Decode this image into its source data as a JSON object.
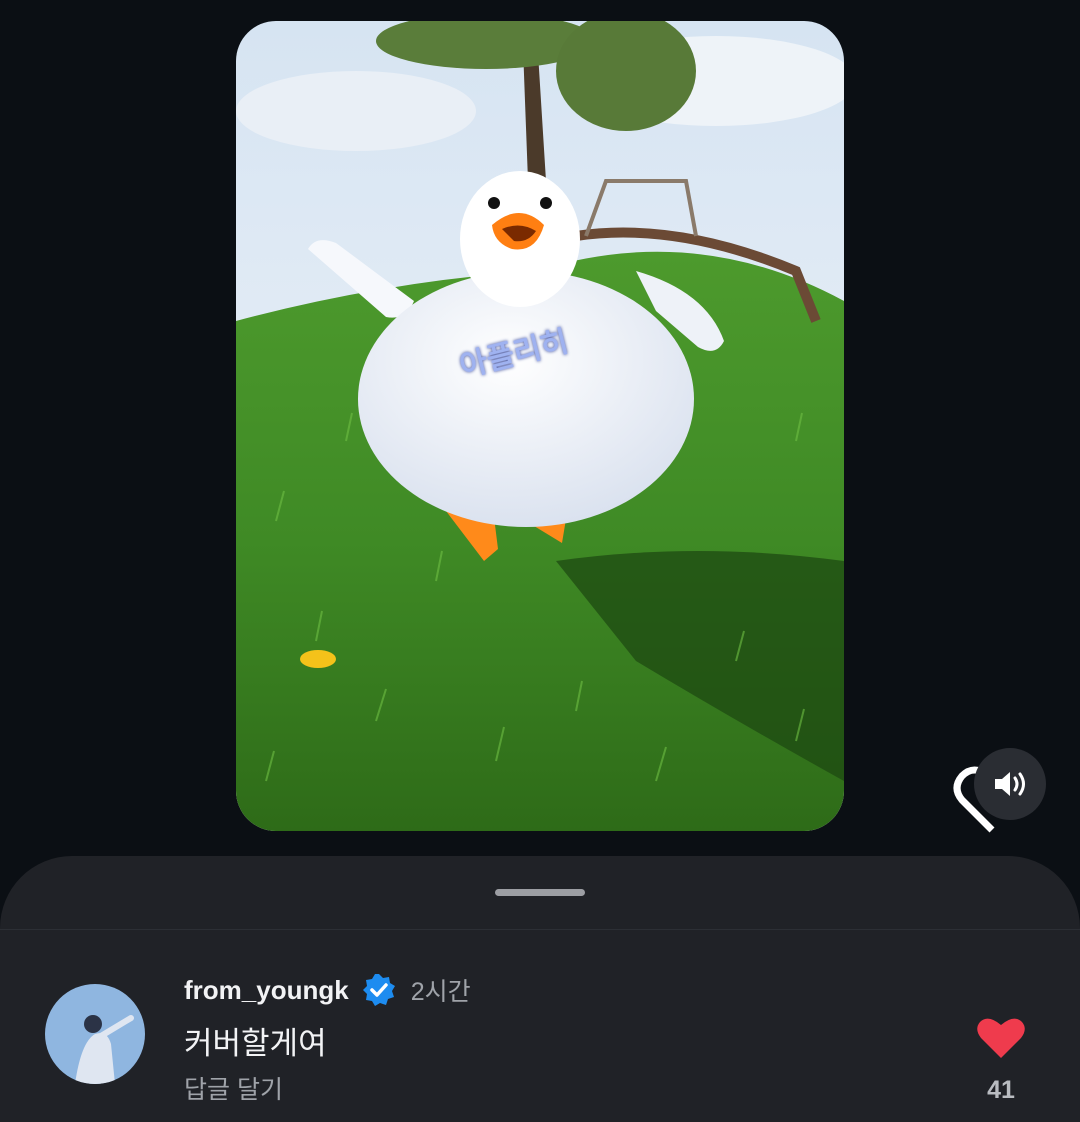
{
  "video": {
    "overlay_text": "아플리히",
    "mute_icon": "speaker-icon",
    "like_icon": "heart-outline-icon"
  },
  "comment": {
    "username": "from_youngk",
    "verified_icon": "verified-badge-icon",
    "time": "2시간",
    "text": "커버할게여",
    "reply_label": "답글 달기",
    "like_icon": "heart-filled-icon",
    "like_count": "41"
  },
  "colors": {
    "background": "#0b0f14",
    "sheet": "#202227",
    "verified": "#1d8cf0",
    "like": "#ef3b4d",
    "muted_text": "#9fa3a9"
  }
}
